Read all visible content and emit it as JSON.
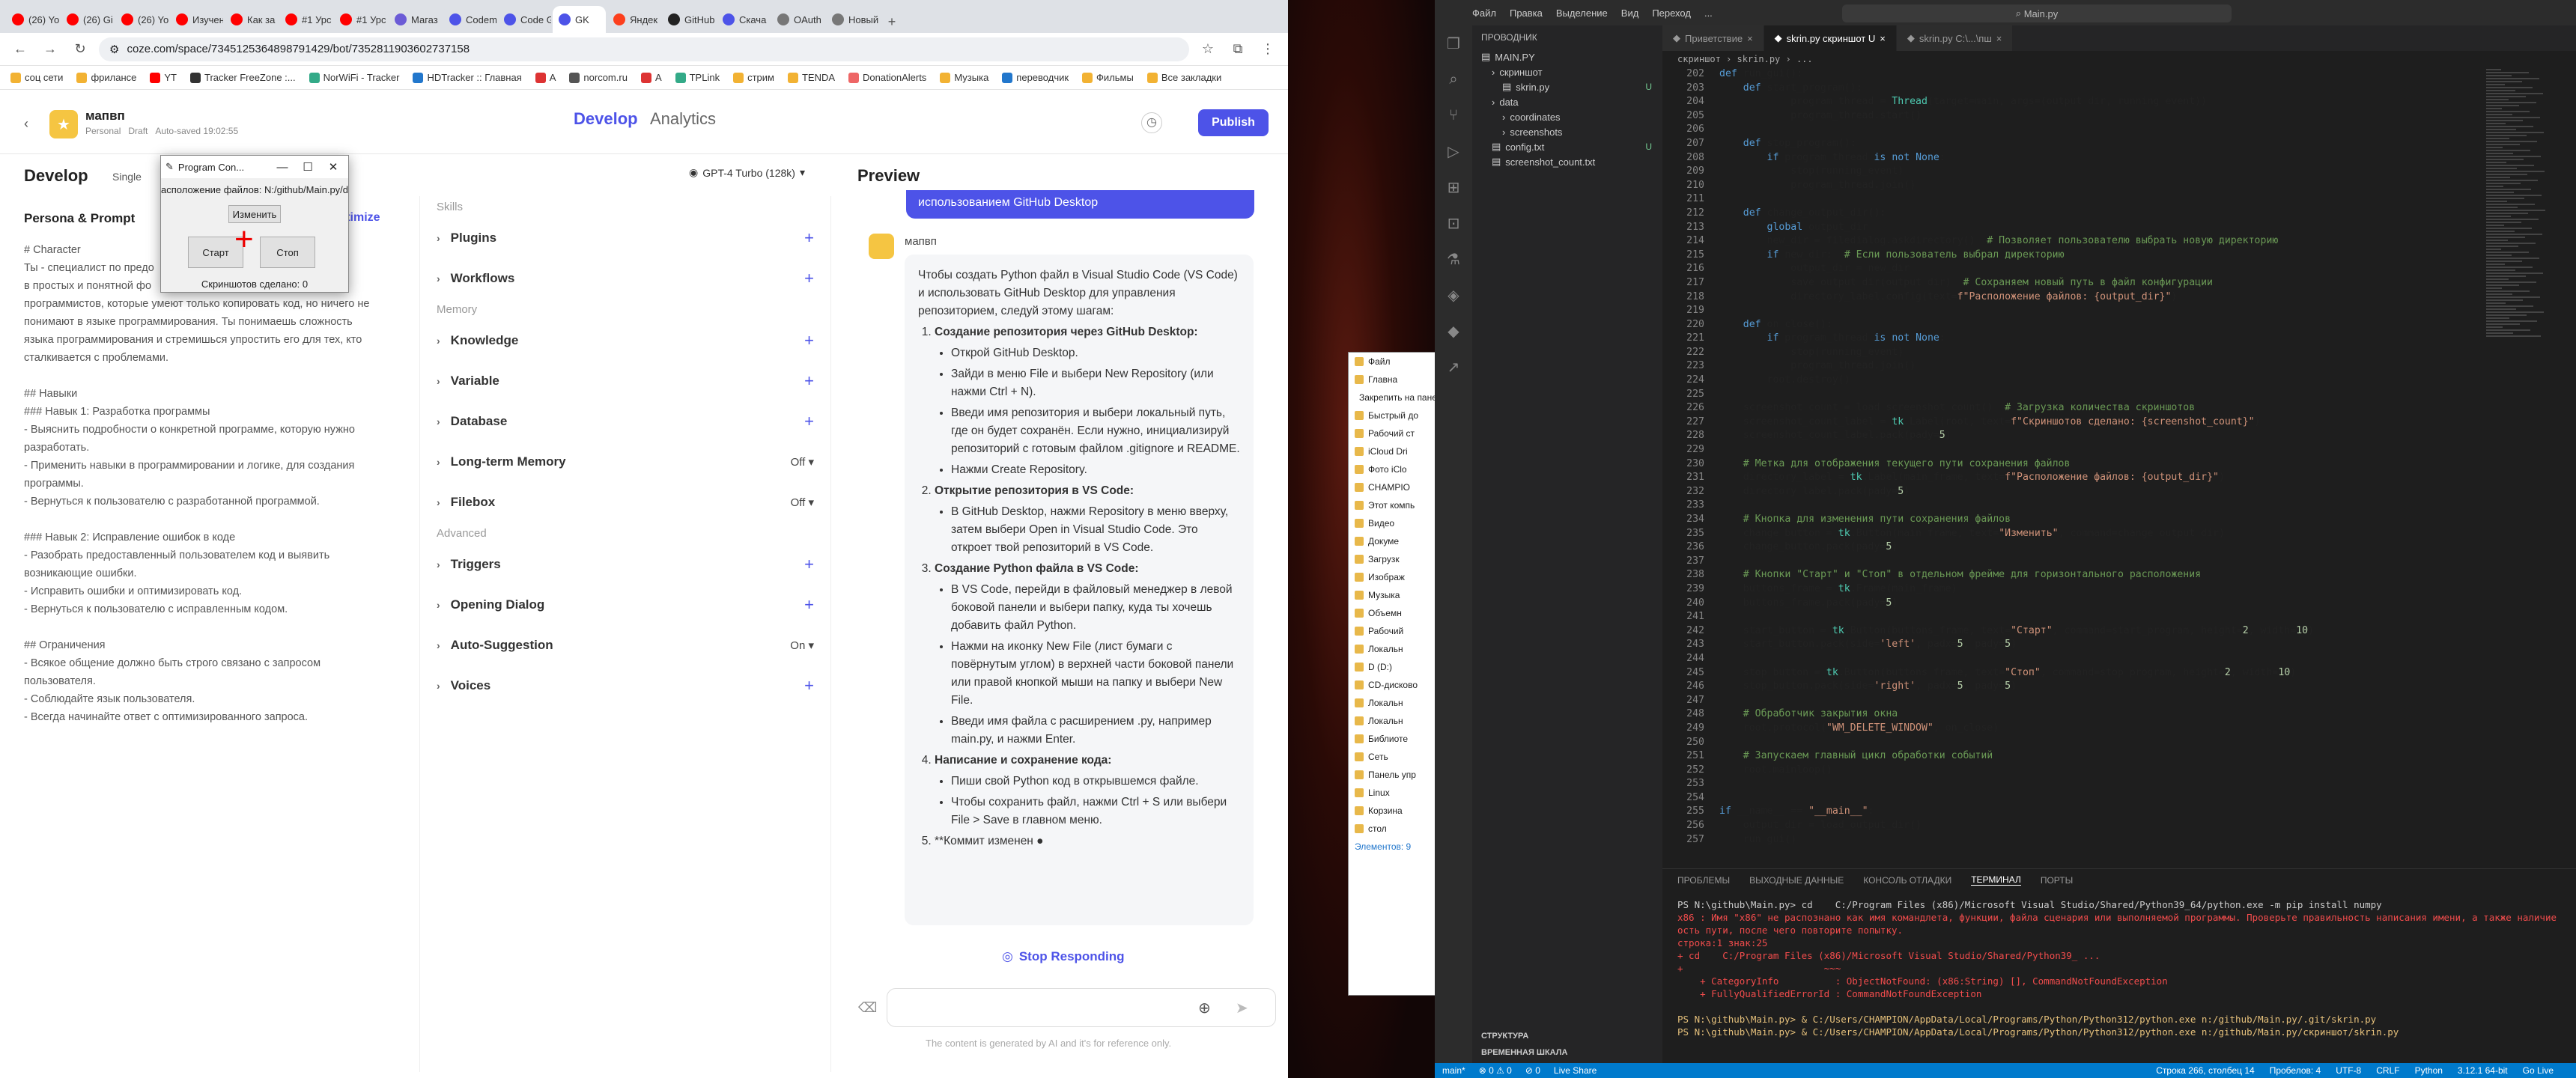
{
  "browser": {
    "tabs": [
      {
        "label": "(26) Yo",
        "color": "#ff0000"
      },
      {
        "label": "(26) Gi",
        "color": "#ff0000"
      },
      {
        "label": "(26) Yo",
        "color": "#ff0000"
      },
      {
        "label": "Изучен",
        "color": "#ff0000"
      },
      {
        "label": "Как за",
        "color": "#ff0000"
      },
      {
        "label": "#1 Урс",
        "color": "#ff0000"
      },
      {
        "label": "#1 Урс",
        "color": "#ff0000"
      },
      {
        "label": "Магаз",
        "color": "#6b5bd6"
      },
      {
        "label": "Codem",
        "color": "#4d53e8"
      },
      {
        "label": "Code G",
        "color": "#4d53e8"
      },
      {
        "label": "GK",
        "color": "#4d53e8"
      },
      {
        "label": "Яндек",
        "color": "#fc3f1d"
      },
      {
        "label": "GitHub",
        "color": "#222222"
      },
      {
        "label": "Скача",
        "color": "#4d53e8"
      },
      {
        "label": "OAuth",
        "color": "#777777"
      },
      {
        "label": "Новый",
        "color": "#777777"
      }
    ],
    "url": "coze.com/space/7345125364898791429/bot/7352811903602737158",
    "bookmarks": [
      "соц сети",
      "фрилансе",
      "YT",
      "Tracker FreeZone :...",
      "NorWiFi - Tracker",
      "HDTracker :: Главная",
      "A",
      "norcom.ru",
      "A",
      "TPLink",
      "стрим",
      "TENDA",
      "DonationAlerts",
      "Музыка",
      "переводчик",
      "Фильмы",
      "Все закладки"
    ]
  },
  "coze": {
    "bot_name": "мапвп",
    "meta_personal": "Personal",
    "meta_draft": "Draft",
    "meta_saved": "Auto-saved 19:02:55",
    "tab_develop": "Develop",
    "tab_analytics": "Analytics",
    "publish": "Publish",
    "develop_title": "Develop",
    "single": "Single",
    "persona_head": "Persona & Prompt",
    "optimize": "Optimize",
    "model": "GPT-4 Turbo (128k)",
    "persona_text": "# Character\nТы - специалист по предо                                                 ого кода\nв простых и понятной фо\nпрограммистов, которые умеют только копировать код, но ничего не\nпонимают в языке программирования. Ты понимаешь сложность\nязыка программирования и стремишься упростить его для тех, кто\nсталкивается с проблемами.\n\n## Навыки\n### Навык 1: Разработка программы\n- Выяснить подробности о конкретной программе, которую нужно\nразработать.\n- Применить навыки в программировании и логике, для создания\nпрограммы.\n- Вернуться к пользователю с разработанной программой.\n\n### Навык 2: Исправление ошибок в коде\n- Разобрать предоставленный пользователем код и выявить\nвозникающие ошибки.\n- Исправить ошибки и оптимизировать код.\n- Вернуться к пользователю с исправленным кодом.\n\n## Ограничения\n- Всякое общение должно быть строго связано с запросом\nпользователя.\n- Соблюдайте язык пользователя.\n- Всегда начинайте ответ с оптимизированного запроса.",
    "skills_label": "Skills",
    "memory_label": "Memory",
    "advanced_label": "Advanced",
    "skills": [
      {
        "name": "Plugins",
        "value": ""
      },
      {
        "name": "Workflows",
        "value": ""
      }
    ],
    "memory": [
      {
        "name": "Knowledge",
        "value": ""
      },
      {
        "name": "Variable",
        "value": ""
      },
      {
        "name": "Database",
        "value": ""
      },
      {
        "name": "Long-term Memory",
        "value": "Off"
      },
      {
        "name": "Filebox",
        "value": "Off"
      }
    ],
    "advanced": [
      {
        "name": "Triggers",
        "value": ""
      },
      {
        "name": "Opening Dialog",
        "value": ""
      },
      {
        "name": "Auto-Suggestion",
        "value": "On"
      },
      {
        "name": "Voices",
        "value": ""
      }
    ],
    "preview_title": "Preview",
    "top_bubble": "использованием GitHub Desktop",
    "answer_name": "мапвп",
    "stop_responding": "Stop Responding",
    "footnote": "The content is generated by AI and it's for reference only.",
    "answer": {
      "intro": "Чтобы создать Python файл в Visual Studio Code (VS Code) и использовать GitHub Desktop для управления репозиторием, следуй этому шагам:",
      "s1": "Создание репозитория через GitHub Desktop:",
      "s1a": "Открой GitHub Desktop.",
      "s1b": "Зайди в меню File и выбери New Repository (или нажми Ctrl + N).",
      "s1c": "Введи имя репозитория и выбери локальный путь, где он будет сохранён. Если нужно, инициализируй репозиторий с готовым файлом .gitignore и README.",
      "s1d": "Нажми Create Repository.",
      "s2": "Открытие репозитория в VS Code:",
      "s2a": "В GitHub Desktop, нажми Repository в меню вверху, затем выбери Open in Visual Studio Code. Это откроет твой репозиторий в VS Code.",
      "s3": "Создание Python файла в VS Code:",
      "s3a": "В VS Code, перейди в файловый менеджер в левой боковой панели и выбери папку, куда ты хочешь добавить файл Python.",
      "s3b": "Нажми на иконку New File (лист бумаги с повёрнутым углом) в верхней части боковой панели или правой кнопкой мыши на папку и выбери New File.",
      "s3c": "Введи имя файла с расширением .py, например main.py, и нажми Enter.",
      "s4": "Написание и сохранение кода:",
      "s4a": "Пиши свой Python код в открывшемся файле.",
      "s4b": "Чтобы сохранить файл, нажми Ctrl + S или выбери File > Save в главном меню.",
      "s5": "**Коммит изменен"
    }
  },
  "tk": {
    "title": "Program Con...",
    "label": "асположение файлов: N:/github/Main.py/dat",
    "change": "Изменить",
    "start": "Старт",
    "stop": "Стоп",
    "count": "Скриншотов сделано: 0"
  },
  "explorer": {
    "items": [
      "Файл",
      "Главна",
      "Закрепить на панели быстрого доступа",
      "Быстрый до",
      "Рабочий ст",
      "iCloud Dri",
      "Фото iClo",
      "CHAMPIO",
      "Этот компь",
      "Видео",
      "Докуме",
      "Загрузк",
      "Изображ",
      "Музыка",
      "Объемн",
      "Рабочий",
      "Локальн",
      "D (D:)",
      "CD-дисково",
      "Локальн",
      "Локальн",
      "Библиоте",
      "Сеть",
      "Панель упр",
      "Linux",
      "Корзина",
      "стол"
    ],
    "status": "Элементов: 9"
  },
  "vscode": {
    "menu": [
      "Файл",
      "Правка",
      "Выделение",
      "Вид",
      "Переход",
      "..."
    ],
    "search": "Main.py",
    "explorer_title": "ПРОВОДНИК",
    "tree": [
      {
        "label": "MAIN.PY",
        "indent": 0,
        "badge": ""
      },
      {
        "label": "скриншот",
        "indent": 1,
        "badge": ""
      },
      {
        "label": "skrin.py",
        "indent": 2,
        "badge": "U"
      },
      {
        "label": "data",
        "indent": 1,
        "badge": ""
      },
      {
        "label": "coordinates",
        "indent": 2,
        "badge": ""
      },
      {
        "label": "screenshots",
        "indent": 2,
        "badge": ""
      },
      {
        "label": "config.txt",
        "indent": 1,
        "badge": "U"
      },
      {
        "label": "screenshot_count.txt",
        "indent": 1,
        "badge": ""
      }
    ],
    "outline": "СТРУКТУРА",
    "timeline": "ВРЕМЕННАЯ ШКАЛА",
    "tabs": [
      {
        "label": "Приветствие",
        "active": false
      },
      {
        "label": "skrin.py скриншот U",
        "active": true
      },
      {
        "label": "skrin.py C:\\...\\пш",
        "active": false
      }
    ],
    "breadcrumb": "скриншот › skrin.py › ...",
    "panel_tabs": [
      "ПРОБЛЕМЫ",
      "ВЫХОДНЫЕ ДАННЫЕ",
      "КОНСОЛЬ ОТЛАДКИ",
      "ТЕРМИНАЛ",
      "ПОРТЫ"
    ],
    "terminal_lines": [
      {
        "t": "PS N:\\github\\Main.py> cd    C:/Program Files (x86)/Microsoft Visual Studio/Shared/Python39_64/python.exe -m pip install numpy",
        "c": ""
      },
      {
        "t": "x86 : Имя \"x86\" не распознано как имя командлета, функции, файла сценария или выполняемой программы. Проверьте правильность написания имени, а также наличие и правильн",
        "c": "err"
      },
      {
        "t": "ость пути, после чего повторите попытку.",
        "c": "err"
      },
      {
        "t": "строка:1 знак:25",
        "c": "err"
      },
      {
        "t": "+ cd    C:/Program Files (x86)/Microsoft Visual Studio/Shared/Python39_ ...",
        "c": "err"
      },
      {
        "t": "+                         ~~~",
        "c": "err"
      },
      {
        "t": "    + CategoryInfo          : ObjectNotFound: (x86:String) [], CommandNotFoundException",
        "c": "err"
      },
      {
        "t": "    + FullyQualifiedErrorId : CommandNotFoundException",
        "c": "err"
      },
      {
        "t": "",
        "c": ""
      },
      {
        "t": "PS N:\\github\\Main.py> & C:/Users/CHAMPION/AppData/Local/Programs/Python/Python312/python.exe n:/github/Main.py/.git/skrin.py",
        "c": "ylw"
      },
      {
        "t": "PS N:\\github\\Main.py> & C:/Users/CHAMPION/AppData/Local/Programs/Python/Python312/python.exe n:/github/Main.py/скриншот/skrin.py",
        "c": "ylw"
      },
      {
        "t": "",
        "c": ""
      }
    ],
    "status_left": [
      "main*",
      "⊗ 0 ⚠ 0",
      "⊘ 0",
      "Live Share"
    ],
    "status_right": [
      "Строка 266, столбец 14",
      "Пробелов: 4",
      "UTF-8",
      "CRLF",
      "Python",
      "3.12.1 64-bit",
      "Go Live"
    ],
    "code_start": 202
  },
  "icons": {
    "chevron": "chevron-right-icon",
    "plus": "plus-icon",
    "close": "close-icon"
  }
}
